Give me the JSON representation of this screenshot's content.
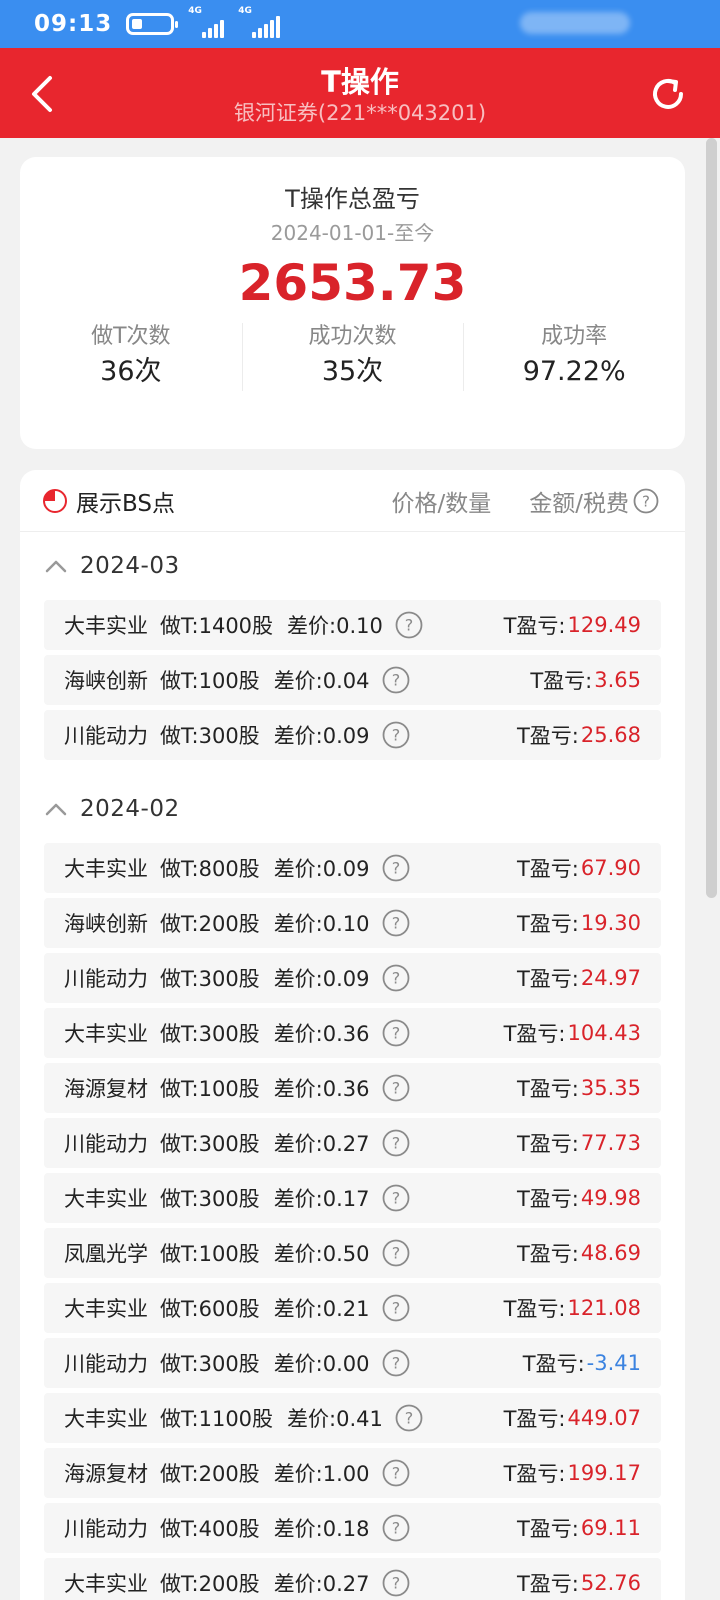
{
  "status_bar": {
    "time": "09:13",
    "network_tag_1": "4G",
    "network_tag_2": "4G"
  },
  "nav": {
    "title": "T操作",
    "subtitle": "银河证券(221***043201)"
  },
  "summary": {
    "title": "T操作总盈亏",
    "period": "2024-01-01-至今",
    "total": "2653.73",
    "stats": [
      {
        "label": "做T次数",
        "value": "36次"
      },
      {
        "label": "成功次数",
        "value": "35次"
      },
      {
        "label": "成功率",
        "value": "97.22%"
      }
    ]
  },
  "list_header": {
    "toggle_label": "展示BS点",
    "col_price": "价格/数量",
    "col_amount": "金额/税费"
  },
  "pl_label": "T盈亏:",
  "months": [
    {
      "label": "2024-03",
      "rows": [
        {
          "name": "大丰实业",
          "qty": "做T:1400股",
          "diff": "差价:0.10",
          "pl": "129.49"
        },
        {
          "name": "海峡创新",
          "qty": "做T:100股",
          "diff": "差价:0.04",
          "pl": "3.65"
        },
        {
          "name": "川能动力",
          "qty": "做T:300股",
          "diff": "差价:0.09",
          "pl": "25.68"
        }
      ]
    },
    {
      "label": "2024-02",
      "rows": [
        {
          "name": "大丰实业",
          "qty": "做T:800股",
          "diff": "差价:0.09",
          "pl": "67.90"
        },
        {
          "name": "海峡创新",
          "qty": "做T:200股",
          "diff": "差价:0.10",
          "pl": "19.30"
        },
        {
          "name": "川能动力",
          "qty": "做T:300股",
          "diff": "差价:0.09",
          "pl": "24.97"
        },
        {
          "name": "大丰实业",
          "qty": "做T:300股",
          "diff": "差价:0.36",
          "pl": "104.43"
        },
        {
          "name": "海源复材",
          "qty": "做T:100股",
          "diff": "差价:0.36",
          "pl": "35.35"
        },
        {
          "name": "川能动力",
          "qty": "做T:300股",
          "diff": "差价:0.27",
          "pl": "77.73"
        },
        {
          "name": "大丰实业",
          "qty": "做T:300股",
          "diff": "差价:0.17",
          "pl": "49.98"
        },
        {
          "name": "凤凰光学",
          "qty": "做T:100股",
          "diff": "差价:0.50",
          "pl": "48.69"
        },
        {
          "name": "大丰实业",
          "qty": "做T:600股",
          "diff": "差价:0.21",
          "pl": "121.08"
        },
        {
          "name": "川能动力",
          "qty": "做T:300股",
          "diff": "差价:0.00",
          "pl": "-3.41"
        },
        {
          "name": "大丰实业",
          "qty": "做T:1100股",
          "diff": "差价:0.41",
          "pl": "449.07"
        },
        {
          "name": "海源复材",
          "qty": "做T:200股",
          "diff": "差价:1.00",
          "pl": "199.17"
        },
        {
          "name": "川能动力",
          "qty": "做T:400股",
          "diff": "差价:0.18",
          "pl": "69.11"
        },
        {
          "name": "大丰实业",
          "qty": "做T:200股",
          "diff": "差价:0.27",
          "pl": "52.76"
        }
      ]
    }
  ],
  "colors": {
    "brand_red": "#e8262e",
    "profit_red": "#d9232a",
    "loss_blue": "#3b83e0",
    "status_blue": "#3a8ef0"
  }
}
